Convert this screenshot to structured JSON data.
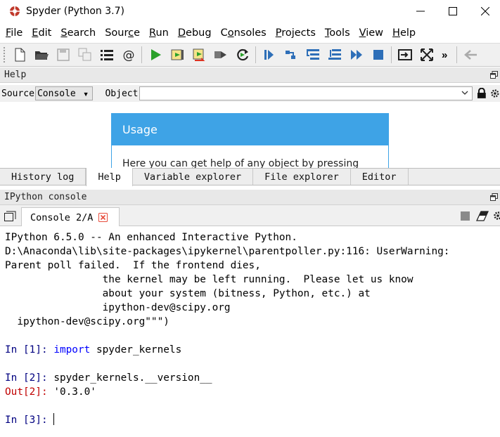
{
  "window": {
    "title": "Spyder (Python 3.7)"
  },
  "menu": [
    {
      "label": "File",
      "u": "F",
      "rest": "ile"
    },
    {
      "label": "Edit",
      "u": "E",
      "rest": "dit"
    },
    {
      "label": "Search",
      "u": "S",
      "rest": "earch"
    },
    {
      "label": "Source",
      "pre": "Sour",
      "u": "c",
      "rest": "e"
    },
    {
      "label": "Run",
      "u": "R",
      "rest": "un"
    },
    {
      "label": "Debug",
      "u": "D",
      "rest": "ebug"
    },
    {
      "label": "Consoles",
      "pre": "C",
      "u": "o",
      "rest": "nsoles"
    },
    {
      "label": "Projects",
      "u": "P",
      "rest": "rojects"
    },
    {
      "label": "Tools",
      "u": "T",
      "rest": "ools"
    },
    {
      "label": "View",
      "u": "V",
      "rest": "iew"
    },
    {
      "label": "Help",
      "u": "H",
      "rest": "elp"
    }
  ],
  "toolbar": {
    "more": "»"
  },
  "help_pane": {
    "title": "Help",
    "source_label": "Source",
    "source_value": "Console",
    "object_label": "Object",
    "object_value": "",
    "usage_title": "Usage",
    "usage_text": "Here you can get help of any object by pressing"
  },
  "pane_tabs": [
    "History log",
    "Help",
    "Variable explorer",
    "File explorer",
    "Editor"
  ],
  "active_pane_tab": "Help",
  "console_pane": {
    "title": "IPython console",
    "tab_label": "Console 2/A"
  },
  "console_lines": {
    "l1": "IPython 6.5.0 -- An enhanced Interactive Python.",
    "l2": "D:\\Anaconda\\lib\\site-packages\\ipykernel\\parentpoller.py:116: UserWarning:",
    "l3": "Parent poll failed.  If the frontend dies,",
    "l4": "                the kernel may be left running.  Please let us know",
    "l5": "                about your system (bitness, Python, etc.) at",
    "l6": "                ipython-dev@scipy.org",
    "l7": "  ipython-dev@scipy.org\"\"\")",
    "in1_prompt": "In [1]: ",
    "in1_kw": "import",
    "in1_rest": " spyder_kernels",
    "in2_prompt": "In [2]: ",
    "in2_code": "spyder_kernels.__version__",
    "out2_prompt": "Out[2]: ",
    "out2_value": "'0.3.0'",
    "in3_prompt": "In [3]: "
  },
  "colors": {
    "usage_header": "#3ea3e6",
    "keyword": "#0000ff",
    "out_prompt": "#c00000"
  }
}
